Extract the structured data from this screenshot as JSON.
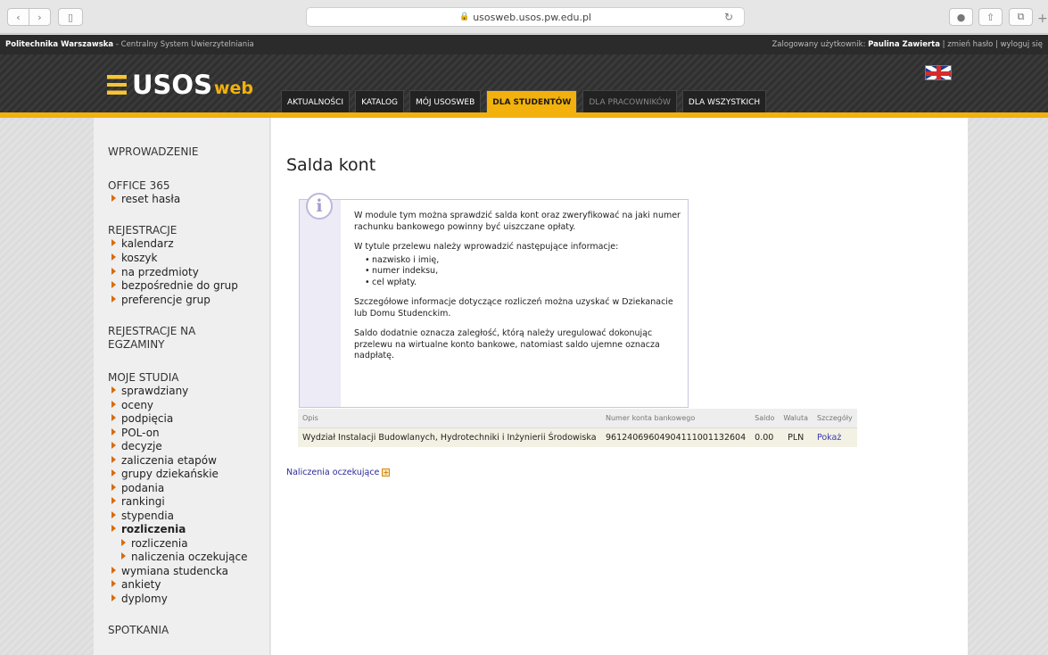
{
  "browser": {
    "url": "usosweb.usos.pw.edu.pl",
    "back_glyph": "‹",
    "forward_glyph": "›",
    "sidebar_glyph": "▯",
    "reload_glyph": "↻",
    "download_glyph": "●",
    "share_glyph": "⇧",
    "tabs_glyph": "⧉",
    "plus_glyph": "+"
  },
  "topbar": {
    "university": "Politechnika Warszawska",
    "system": " - Centralny System Uwierzytelniania",
    "logged_label": "Zalogowany użytkownik: ",
    "user_name": "Paulina Zawierta",
    "change_password": " | zmień hasło | ",
    "logout": "wyloguj się"
  },
  "header": {
    "logo_main": "USOS",
    "logo_sub": "web",
    "tabs": [
      "AKTUALNOŚCI",
      "KATALOG",
      "MÓJ USOSWEB",
      "DLA STUDENTÓW",
      "DLA PRACOWNIKÓW",
      "DLA WSZYSTKICH"
    ]
  },
  "menu": {
    "intro": "WPROWADZENIE",
    "office": "OFFICE 365",
    "office_items": [
      "reset hasła"
    ],
    "registrations": "REJESTRACJE",
    "registration_items": [
      "kalendarz",
      "koszyk",
      "na przedmioty",
      "bezpośrednie do grup",
      "preferencje grup"
    ],
    "exam_registrations_1": "REJESTRACJE NA",
    "exam_registrations_2": "EGZAMINY",
    "studies": "MOJE STUDIA",
    "studies_items": [
      "sprawdziany",
      "oceny",
      "podpięcia",
      "POL-on",
      "decyzje",
      "zaliczenia etapów",
      "grupy dziekańskie",
      "podania",
      "rankingi",
      "stypendia"
    ],
    "settlements": "rozliczenia",
    "settlements_sub": [
      "rozliczenia",
      "naliczenia oczekujące"
    ],
    "studies_items_after": [
      "wymiana studencka",
      "ankiety",
      "dyplomy"
    ],
    "meetings": "SPOTKANIA"
  },
  "main": {
    "title": "Salda kont",
    "info_icon": "i",
    "info_p1": "W module tym można sprawdzić salda kont oraz zweryfikować na jaki numer rachunku bankowego powinny być uiszczane opłaty.",
    "info_p2": "W tytule przelewu należy wprowadzić następujące informacje:",
    "info_list": [
      "nazwisko i imię,",
      "numer indeksu,",
      "cel wpłaty."
    ],
    "info_p3": "Szczegółowe informacje dotyczące rozliczeń można uzyskać w Dziekanacie lub Domu Studenckim.",
    "info_p4": "Saldo dodatnie oznacza zaległość, którą należy uregulować dokonując przelewu na wirtualne konto bankowe, natomiast saldo ujemne oznacza nadpłatę.",
    "table": {
      "headers": [
        "Opis",
        "Numer konta bankowego",
        "Saldo",
        "Waluta",
        "Szczegóły"
      ],
      "rows": [
        [
          "Wydział Instalacji Budowlanych, Hydrotechniki i Inżynierii Środowiska",
          "96124069604904111001132604",
          "0.00",
          "PLN",
          "Pokaż"
        ]
      ]
    },
    "pending_link": "Naliczenia oczekujące",
    "pending_glyph": "+"
  }
}
